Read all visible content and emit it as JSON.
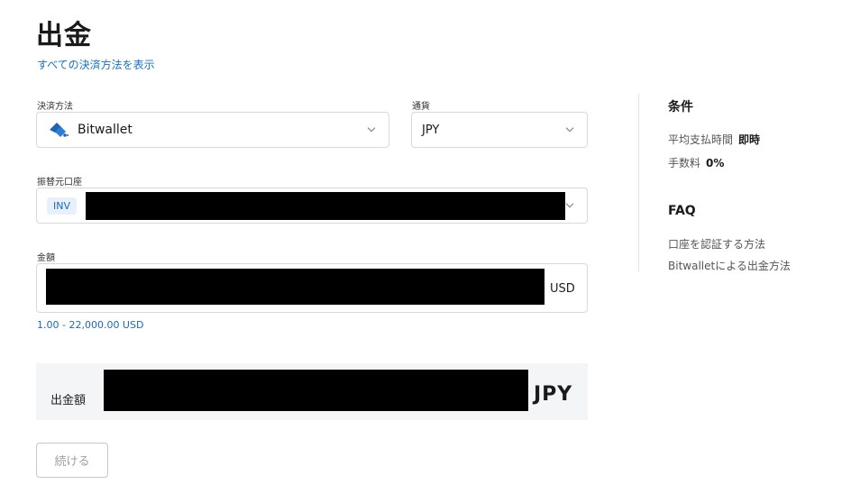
{
  "page": {
    "title": "出金",
    "all_methods_link": "すべての決済方法を表示"
  },
  "form": {
    "payment_method": {
      "label": "決済方法",
      "value": "Bitwallet"
    },
    "currency": {
      "label": "通貨",
      "value": "JPY"
    },
    "source_account": {
      "label": "振替元口座",
      "badge": "INV"
    },
    "amount": {
      "label": "金額",
      "suffix": "USD",
      "range": "1.00 - 22,000.00 USD"
    }
  },
  "summary": {
    "label": "出金額",
    "currency": "JPY"
  },
  "actions": {
    "continue_label": "続ける"
  },
  "sidebar": {
    "conditions_heading": "条件",
    "avg_time_label": "平均支払時間",
    "avg_time_value": "即時",
    "fee_label": "手数料",
    "fee_value": "0%",
    "faq_heading": "FAQ",
    "faq_links": [
      "口座を認証する方法",
      "Bitwalletによる出金方法"
    ]
  },
  "colors": {
    "link": "#1672c4",
    "bitwallet_blue": "#1e64b4"
  }
}
